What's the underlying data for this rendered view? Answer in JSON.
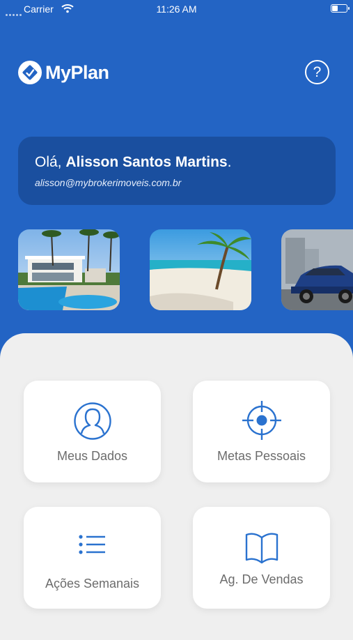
{
  "status_bar": {
    "carrier": "Carrier",
    "time": "11:26 AM",
    "battery_level": 0.4
  },
  "header": {
    "logo_text": "MyPlan",
    "help_label": "?"
  },
  "greeting": {
    "salutation": "Olá,",
    "name": "Alisson Santos Martins",
    "suffix": ".",
    "email": "alisson@mybrokerimoveis.com.br"
  },
  "carousel": {
    "items": [
      {
        "subject": "luxury-house-with-pool"
      },
      {
        "subject": "tropical-beach-with-palm-tree"
      },
      {
        "subject": "blue-suv-car"
      }
    ]
  },
  "menu": {
    "tiles": [
      {
        "label": "Meus Dados",
        "icon": "user-icon"
      },
      {
        "label": "Metas Pessoais",
        "icon": "target-icon"
      },
      {
        "label": "Ações Semanais",
        "icon": "list-icon"
      },
      {
        "label": "Ag. De Vendas",
        "icon": "book-icon"
      }
    ]
  },
  "colors": {
    "brand_blue": "#2364c4",
    "card_blue": "#1a4f9f",
    "icon_blue": "#2a72cf",
    "panel_gray": "#efefef"
  }
}
